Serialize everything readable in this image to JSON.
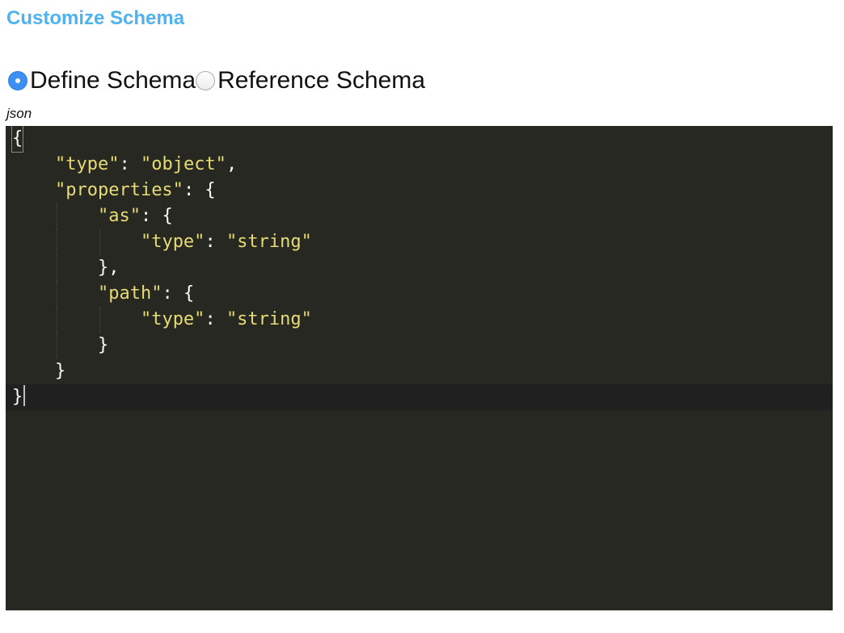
{
  "header": {
    "title": "Customize Schema"
  },
  "schema_mode": {
    "options": [
      {
        "label": "Define Schema",
        "checked": true
      },
      {
        "label": "Reference Schema",
        "checked": false
      }
    ]
  },
  "editor": {
    "mode_label": "json",
    "theme_colors": {
      "background": "#272822",
      "string": "#e6db74",
      "punctuation": "#f8f8f2"
    },
    "lines": [
      "{",
      "    \"type\": \"object\",",
      "    \"properties\": {",
      "        \"as\": {",
      "            \"type\": \"string\"",
      "        },",
      "        \"path\": {",
      "            \"type\": \"string\"",
      "        }",
      "    }",
      "}"
    ]
  }
}
